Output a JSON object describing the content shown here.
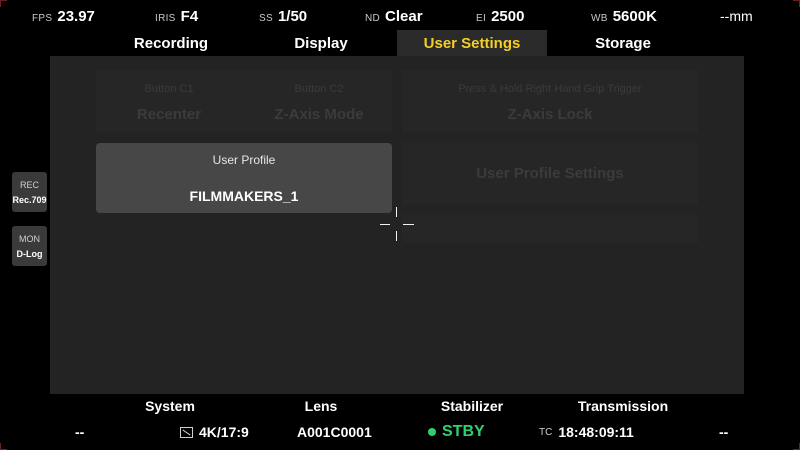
{
  "status_bar": {
    "fps": {
      "label": "FPS",
      "value": "23.97"
    },
    "iris": {
      "label": "IRIS",
      "value": "F4"
    },
    "ss": {
      "label": "SS",
      "value": "1/50"
    },
    "nd": {
      "label": "ND",
      "value": "Clear"
    },
    "ei": {
      "label": "EI",
      "value": "2500"
    },
    "wb": {
      "label": "WB",
      "value": "5600K"
    },
    "distance": {
      "value": "--mm"
    }
  },
  "tabs": [
    {
      "label": "Recording",
      "active": false
    },
    {
      "label": "Display",
      "active": false
    },
    {
      "label": "User Settings",
      "active": true
    },
    {
      "label": "Storage",
      "active": false
    }
  ],
  "settings": {
    "button_c1": {
      "label": "Button C1",
      "value": "Recenter"
    },
    "button_c2": {
      "label": "Button C2",
      "value": "Z-Axis Mode"
    },
    "trigger": {
      "label": "Press & Hold Right Hand Grip Trigger",
      "value": "Z-Axis Lock"
    },
    "user_profile_settings": {
      "label": "User Profile Settings"
    }
  },
  "user_profile": {
    "title": "User Profile",
    "value": "FILMMAKERS_1"
  },
  "side": {
    "rec": {
      "label": "REC",
      "value": "Rec.709"
    },
    "mon": {
      "label": "MON",
      "value": "D-Log"
    }
  },
  "bottom_menu": [
    "System",
    "Lens",
    "Stabilizer",
    "Transmission"
  ],
  "bottom_status": {
    "left": "--",
    "resolution": "4K/17:9",
    "clip": "A001C0001",
    "state": "STBY",
    "tc_label": "TC",
    "timecode": "18:48:09:11",
    "right": "--"
  },
  "colors": {
    "accent": "#f3cf27",
    "status_green": "#2fd16e",
    "background": "#000000",
    "panel": "#232323"
  }
}
